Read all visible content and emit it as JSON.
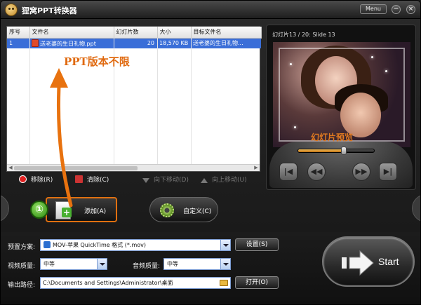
{
  "titlebar": {
    "title": "狸窝PPT转换器",
    "menu_label": "Menu",
    "minimize": "−",
    "close": "×"
  },
  "file_table": {
    "headers": [
      "序号",
      "文件名",
      "幻灯片数",
      "大小",
      "目标文件名"
    ],
    "rows": [
      {
        "index": "1",
        "filename": "送老婆的生日礼物.ppt",
        "slides": "20",
        "size": "18,570 KB",
        "target": "送老婆的生日礼物..."
      }
    ]
  },
  "actions": {
    "remove": "移除(R)",
    "clear": "清除(C)",
    "move_down": "向下移动(D)",
    "move_up": "向上移动(U)"
  },
  "preview": {
    "slide_label": "幻灯片13 / 20: Slide 13",
    "slider_progress": 0.6
  },
  "buttons": {
    "add": "添加(A)",
    "custom": "自定义(C)",
    "start": "Start",
    "step": "①"
  },
  "settings": {
    "preset_label": "预置方案:",
    "preset_value": "MOV-苹果 QuickTime 格式 (*.mov)",
    "preset_button": "设置(S)",
    "video_quality_label": "视频质量:",
    "video_quality_value": "中等",
    "audio_quality_label": "音频质量:",
    "audio_quality_value": "中等",
    "output_label": "输出路径:",
    "output_value": "C:\\Documents and Settings\\Administrator\\桌面",
    "open_button": "打开(O)"
  },
  "annotations": {
    "main": "PPT版本不限",
    "preview": "幻灯片预览"
  },
  "colors": {
    "accent": "#e06a10",
    "selection": "#3a6ed8"
  }
}
